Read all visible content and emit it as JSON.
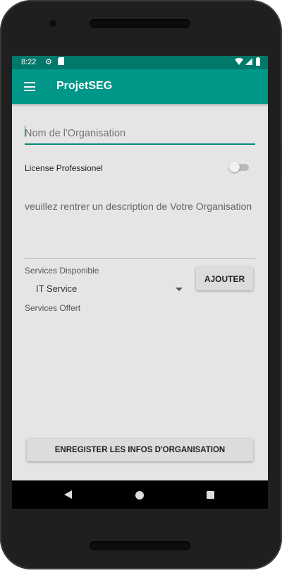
{
  "status_bar": {
    "time": "8:22",
    "icons": [
      "settings-icon",
      "sd-card-icon",
      "wifi-icon",
      "signal-icon",
      "battery-icon"
    ]
  },
  "app_bar": {
    "title": "ProjetSEG",
    "menu_icon": "hamburger-menu-icon"
  },
  "form": {
    "org_name_placeholder": "Nom de l'Organisation",
    "license_label": "License Professionel",
    "license_on": false,
    "description_placeholder": "veuillez rentrer un description de Votre Organisation",
    "services_disponible_label": "Services Disponible",
    "services_selected": "IT Service",
    "add_button_label": "AJOUTER",
    "services_offert_label": "Services Offert",
    "save_button_label": "ENREGISTER LES INFOS D'ORGANISATION"
  },
  "colors": {
    "primary": "#009688",
    "primary_dark": "#00796b",
    "background": "#e5e5e5"
  },
  "nav_bar": {
    "icons": [
      "back-icon",
      "home-icon",
      "recent-apps-icon"
    ]
  }
}
